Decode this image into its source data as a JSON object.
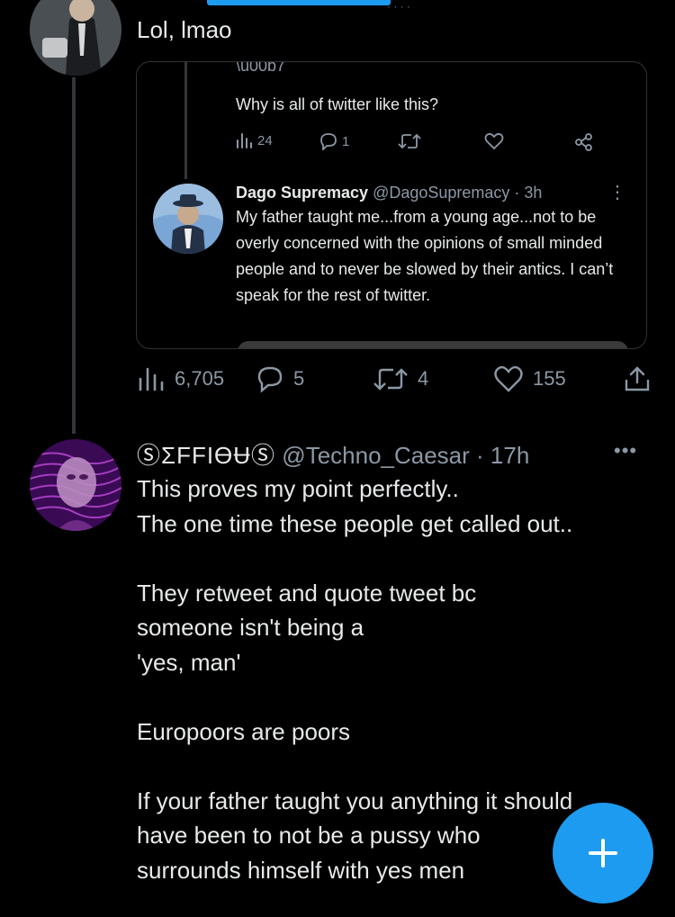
{
  "top_fragment": "· ·  ·  ·",
  "reply": {
    "text": "Lol, lmao"
  },
  "quote": {
    "partial_text": "Why is all of twitter like this?",
    "actions": {
      "views": "24",
      "replies": "1"
    },
    "author_name": "Dago Supremacy",
    "author_meta": "@DagoSupremacy · 3h",
    "body": "My father taught me...from a young age...not to be overly concerned with the opinions of small minded people and to never be slowed by their antics.  I can’t speak for the rest of twitter."
  },
  "reply_actions": {
    "views": "6,705",
    "replies": "5",
    "retweets": "4",
    "likes": "155"
  },
  "tweet": {
    "author_name": "ⓈΣFFIϴɄⓈ",
    "author_meta": "@Techno_Caesar · 17h",
    "paragraphs": [
      "This proves my point perfectly..\nThe one time these people get called out..",
      "They retweet and quote tweet bc someone isn't being a\n'yes, man'",
      "Europoors are poors",
      "If your father taught you anything it should have been to not be a pussy who surrounds himself with yes men"
    ]
  },
  "fab": {
    "label": "+"
  },
  "colors": {
    "accent": "#1d9bf0",
    "background": "#000000",
    "text": "#e7e9ea",
    "secondary": "#8b98a5",
    "border": "#2f3336"
  }
}
